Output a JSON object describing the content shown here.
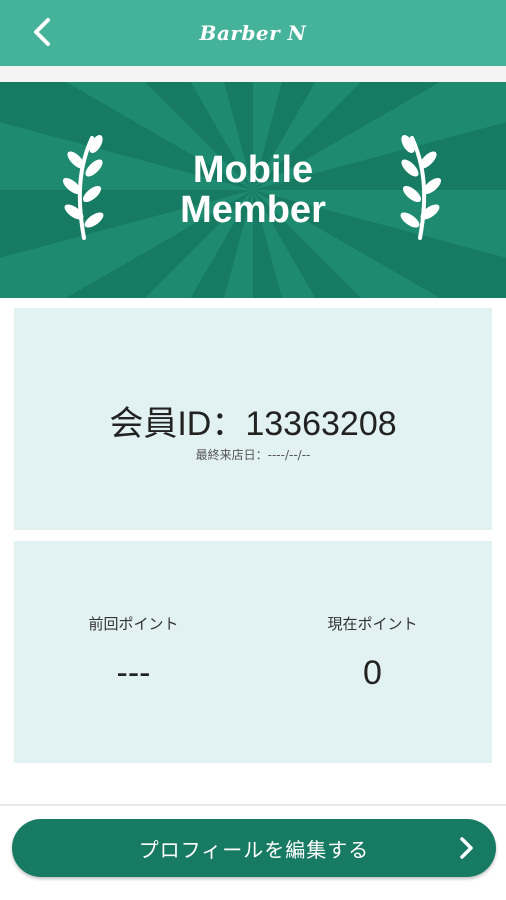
{
  "header": {
    "logo_text": "Barber N",
    "back_icon": "chevron-left-icon",
    "color": "#45b39a"
  },
  "banner": {
    "title_line1": "Mobile",
    "title_line2": "Member",
    "decoration_icons": [
      "laurel-left-icon",
      "laurel-right-icon"
    ],
    "color": "#177a62"
  },
  "member": {
    "id_label": "会員ID：13363208",
    "last_visit": "最終来店日：----/--/--"
  },
  "points": {
    "previous_label": "前回ポイント",
    "previous_value": "---",
    "current_label": "現在ポイント",
    "current_value": "0"
  },
  "actions": {
    "profile_button_label": "プロフィールを編集する",
    "profile_button_icon": "chevron-right-icon",
    "color": "#177a62"
  }
}
